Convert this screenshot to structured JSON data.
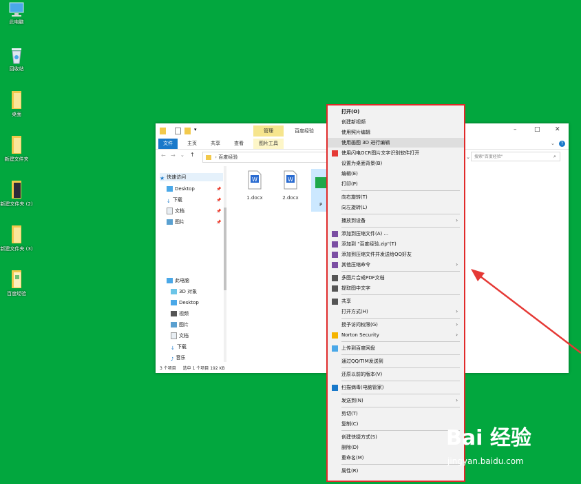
{
  "desktop": {
    "icons": [
      {
        "label": "此电脑"
      },
      {
        "label": "回收站"
      },
      {
        "label": "桌面"
      },
      {
        "label": "新建文件夹"
      },
      {
        "label": "新建文件夹 (2)"
      },
      {
        "label": "新建文件夹 (3)"
      },
      {
        "label": "百度经验"
      }
    ]
  },
  "explorer": {
    "title": "百度经验",
    "context_tab": "管理",
    "ribbon_tabs": [
      "文件",
      "主页",
      "共享",
      "查看",
      "图片工具"
    ],
    "address": "百度经验",
    "search_placeholder": "搜索\"百度经验\"",
    "window_controls": {
      "minimize": "–",
      "maximize": "□",
      "close": "✕"
    },
    "nav": {
      "quick_access": "快速访问",
      "items": [
        "Desktop",
        "下载",
        "文档",
        "图片"
      ],
      "this_pc": "此电脑",
      "pc_items": [
        "3D 对象",
        "Desktop",
        "视频",
        "图片",
        "文档",
        "下载",
        "音乐"
      ]
    },
    "files": [
      {
        "name": "1.docx"
      },
      {
        "name": "2.docx"
      },
      {
        "name": "P"
      }
    ],
    "status": {
      "count": "3 个项目",
      "selected": "选中 1 个项目  192 KB"
    }
  },
  "context_menu": {
    "items": [
      {
        "label": "打开(O)",
        "bold": true
      },
      {
        "label": "创建新视频"
      },
      {
        "label": "使用照片编辑"
      },
      {
        "label": "使用画图 3D 进行编辑",
        "highlight": true
      },
      {
        "label": "使用闪电OCR图片文字识别软件打开",
        "icon": "ocr"
      },
      {
        "label": "设置为桌面背景(B)"
      },
      {
        "label": "编辑(E)"
      },
      {
        "label": "打印(P)"
      },
      {
        "sep": true
      },
      {
        "label": "向右旋转(T)"
      },
      {
        "label": "向左旋转(L)"
      },
      {
        "sep": true
      },
      {
        "label": "播放到设备",
        "arrow": true
      },
      {
        "sep": true
      },
      {
        "label": "添加到压缩文件(A) ...",
        "icon": "rar"
      },
      {
        "label": "添加到 \"百度经验.zip\"(T)",
        "icon": "rar"
      },
      {
        "label": "添加到压缩文件并发送给QQ好友",
        "icon": "rar"
      },
      {
        "label": "其他压缩命令",
        "icon": "rar",
        "arrow": true
      },
      {
        "sep": true
      },
      {
        "label": "多图片合成PDF文档",
        "icon": "pdf"
      },
      {
        "label": "提取图中文字",
        "icon": "txt"
      },
      {
        "sep": true
      },
      {
        "label": "共享",
        "icon": "share"
      },
      {
        "label": "打开方式(H)",
        "arrow": true
      },
      {
        "sep": true
      },
      {
        "label": "授予访问权限(G)",
        "arrow": true
      },
      {
        "label": "Norton Security",
        "icon": "norton",
        "arrow": true
      },
      {
        "sep": true
      },
      {
        "label": "上传到百度网盘",
        "icon": "cloud"
      },
      {
        "sep": true
      },
      {
        "label": "通过QQ/TIM发送到"
      },
      {
        "sep": true
      },
      {
        "label": "还原以前的版本(V)"
      },
      {
        "sep": true
      },
      {
        "label": "扫描病毒(电脑管家)",
        "icon": "shield"
      },
      {
        "sep": true
      },
      {
        "label": "发送到(N)",
        "arrow": true
      },
      {
        "sep": true
      },
      {
        "label": "剪切(T)"
      },
      {
        "label": "复制(C)"
      },
      {
        "sep": true
      },
      {
        "label": "创建快捷方式(S)"
      },
      {
        "label": "删除(D)"
      },
      {
        "label": "重命名(M)"
      },
      {
        "sep": true
      },
      {
        "label": "属性(R)"
      }
    ]
  },
  "watermark": {
    "logo": "Bai 经验",
    "url": "jingyan.baidu.com"
  },
  "colors": {
    "desktop": "#02a73e",
    "highlight_border": "#e02a2a",
    "arrow": "#e53935",
    "accent": "#1979ca"
  }
}
